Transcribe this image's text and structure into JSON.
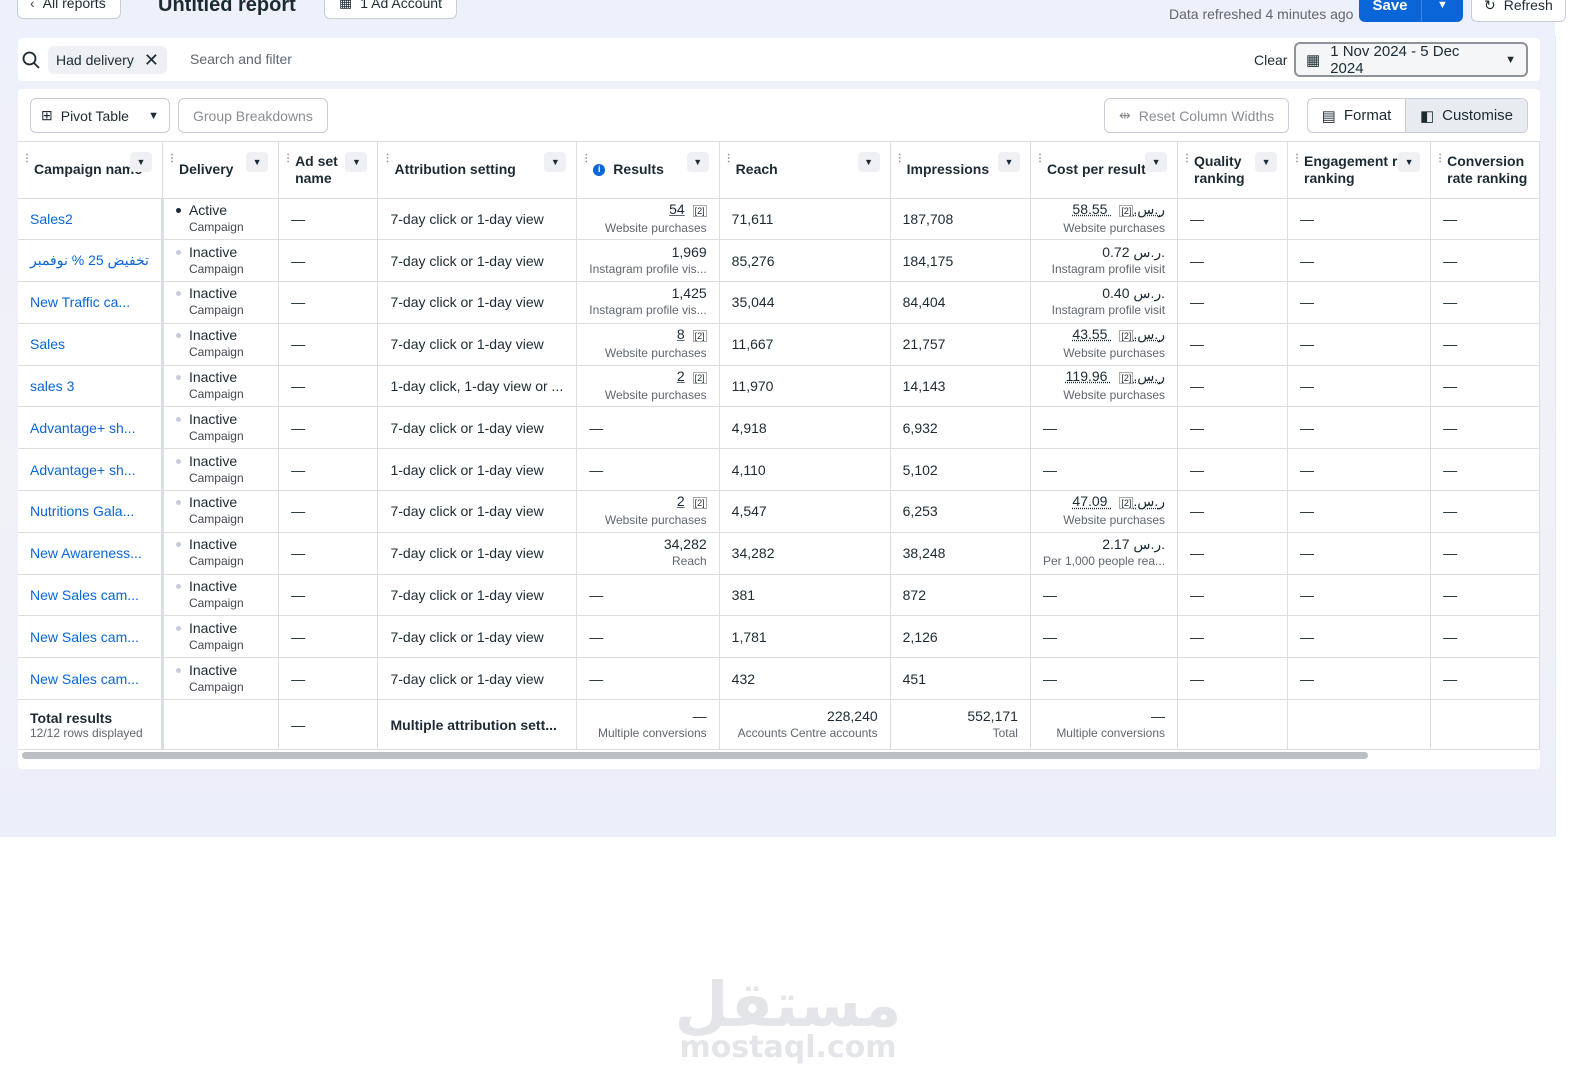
{
  "header": {
    "back_label": "All reports",
    "title": "Untitled report",
    "account_label": "1 Ad Account",
    "refreshed_text": "Data refreshed 4 minutes ago",
    "save_label": "Save",
    "refresh_label": "Refresh"
  },
  "filter": {
    "chip_label": "Had delivery",
    "placeholder": "Search and filter",
    "clear_label": "Clear",
    "date_range": "1 Nov 2024 - 5 Dec 2024"
  },
  "toolbar": {
    "pivot_label": "Pivot Table",
    "group_label": "Group Breakdowns",
    "reset_label": "Reset Column Widths",
    "format_label": "Format",
    "customise_label": "Customise"
  },
  "columns": [
    "Campaign name",
    "Delivery",
    "Ad set name",
    "Attribution setting",
    "Results",
    "Reach",
    "Impressions",
    "Cost per result",
    "Quality ranking",
    "Engagement rate ranking",
    "Conversion rate ranking"
  ],
  "rows": [
    {
      "name": "Sales2",
      "status": "Active",
      "type": "Campaign",
      "adset": "—",
      "attribution": "7-day click or 1-day view",
      "result": "54",
      "result_sub": "Website purchases",
      "result_tag": "[2]",
      "reach": "71,611",
      "impressions": "187,708",
      "cpr": "58.55 ر.س.",
      "cpr_sub": "Website purchases",
      "cpr_tag": "[2]",
      "quality": "—",
      "engagement": "—",
      "conversion": "—"
    },
    {
      "name": "تخفيض 25 % نوفمبر",
      "status": "Inactive",
      "type": "Campaign",
      "adset": "—",
      "attribution": "7-day click or 1-day view",
      "result": "1,969",
      "result_sub": "Instagram profile vis...",
      "result_tag": "",
      "reach": "85,276",
      "impressions": "184,175",
      "cpr": "0.72 ر.س.",
      "cpr_sub": "Instagram profile visit",
      "cpr_tag": "",
      "quality": "—",
      "engagement": "—",
      "conversion": "—"
    },
    {
      "name": "New Traffic ca...",
      "status": "Inactive",
      "type": "Campaign",
      "adset": "—",
      "attribution": "7-day click or 1-day view",
      "result": "1,425",
      "result_sub": "Instagram profile vis...",
      "result_tag": "",
      "reach": "35,044",
      "impressions": "84,404",
      "cpr": "0.40 ر.س.",
      "cpr_sub": "Instagram profile visit",
      "cpr_tag": "",
      "quality": "—",
      "engagement": "—",
      "conversion": "—"
    },
    {
      "name": "Sales",
      "status": "Inactive",
      "type": "Campaign",
      "adset": "—",
      "attribution": "7-day click or 1-day view",
      "result": "8",
      "result_sub": "Website purchases",
      "result_tag": "[2]",
      "reach": "11,667",
      "impressions": "21,757",
      "cpr": "43.55 ر.س.",
      "cpr_sub": "Website purchases",
      "cpr_tag": "[2]",
      "quality": "—",
      "engagement": "—",
      "conversion": "—"
    },
    {
      "name": "sales 3",
      "status": "Inactive",
      "type": "Campaign",
      "adset": "—",
      "attribution": "1-day click, 1-day view or ...",
      "result": "2",
      "result_sub": "Website purchases",
      "result_tag": "[2]",
      "reach": "11,970",
      "impressions": "14,143",
      "cpr": "119.96 ر.س.",
      "cpr_sub": "Website purchases",
      "cpr_tag": "[2]",
      "quality": "—",
      "engagement": "—",
      "conversion": "—"
    },
    {
      "name": "Advantage+ sh...",
      "status": "Inactive",
      "type": "Campaign",
      "adset": "—",
      "attribution": "7-day click or 1-day view",
      "result": "—",
      "result_sub": "",
      "result_tag": "",
      "reach": "4,918",
      "impressions": "6,932",
      "cpr": "—",
      "cpr_sub": "",
      "cpr_tag": "",
      "quality": "—",
      "engagement": "—",
      "conversion": "—"
    },
    {
      "name": "Advantage+ sh...",
      "status": "Inactive",
      "type": "Campaign",
      "adset": "—",
      "attribution": "1-day click or 1-day view",
      "result": "—",
      "result_sub": "",
      "result_tag": "",
      "reach": "4,110",
      "impressions": "5,102",
      "cpr": "—",
      "cpr_sub": "",
      "cpr_tag": "",
      "quality": "—",
      "engagement": "—",
      "conversion": "—"
    },
    {
      "name": "Nutritions Gala...",
      "status": "Inactive",
      "type": "Campaign",
      "adset": "—",
      "attribution": "7-day click or 1-day view",
      "result": "2",
      "result_sub": "Website purchases",
      "result_tag": "[2]",
      "reach": "4,547",
      "impressions": "6,253",
      "cpr": "47.09 ر.س.",
      "cpr_sub": "Website purchases",
      "cpr_tag": "[2]",
      "quality": "—",
      "engagement": "—",
      "conversion": "—"
    },
    {
      "name": "New Awareness...",
      "status": "Inactive",
      "type": "Campaign",
      "adset": "—",
      "attribution": "7-day click or 1-day view",
      "result": "34,282",
      "result_sub": "Reach",
      "result_tag": "",
      "reach": "34,282",
      "impressions": "38,248",
      "cpr": "2.17 ر.س.",
      "cpr_sub": "Per 1,000 people rea...",
      "cpr_tag": "",
      "quality": "—",
      "engagement": "—",
      "conversion": "—"
    },
    {
      "name": "New Sales cam...",
      "status": "Inactive",
      "type": "Campaign",
      "adset": "—",
      "attribution": "7-day click or 1-day view",
      "result": "—",
      "result_sub": "",
      "result_tag": "",
      "reach": "381",
      "impressions": "872",
      "cpr": "—",
      "cpr_sub": "",
      "cpr_tag": "",
      "quality": "—",
      "engagement": "—",
      "conversion": "—"
    },
    {
      "name": "New Sales cam...",
      "status": "Inactive",
      "type": "Campaign",
      "adset": "—",
      "attribution": "7-day click or 1-day view",
      "result": "—",
      "result_sub": "",
      "result_tag": "",
      "reach": "1,781",
      "impressions": "2,126",
      "cpr": "—",
      "cpr_sub": "",
      "cpr_tag": "",
      "quality": "—",
      "engagement": "—",
      "conversion": "—"
    },
    {
      "name": "New Sales cam...",
      "status": "Inactive",
      "type": "Campaign",
      "adset": "—",
      "attribution": "7-day click or 1-day view",
      "result": "—",
      "result_sub": "",
      "result_tag": "",
      "reach": "432",
      "impressions": "451",
      "cpr": "—",
      "cpr_sub": "",
      "cpr_tag": "",
      "quality": "—",
      "engagement": "—",
      "conversion": "—"
    }
  ],
  "totals": {
    "label": "Total results",
    "sub": "12/12 rows displayed",
    "adset": "—",
    "attribution": "Multiple attribution sett...",
    "result": "—",
    "result_sub": "Multiple conversions",
    "reach": "228,240",
    "reach_sub": "Accounts Centre accounts",
    "impressions": "552,171",
    "impressions_sub": "Total",
    "cpr": "—",
    "cpr_sub": "Multiple conversions"
  },
  "watermark": {
    "arabic": "مستقل",
    "latin": "mostaql.com"
  }
}
